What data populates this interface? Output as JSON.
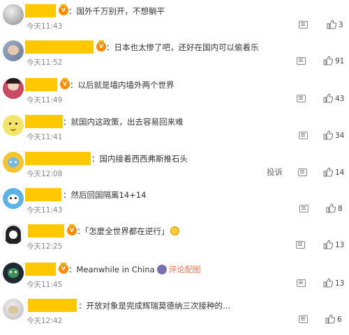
{
  "comments": [
    {
      "text": "：国外千万别开，不想躺平",
      "time": "今天11:43",
      "likes": "3"
    },
    {
      "text": "：日本也太惨了吧，还好在国内可以偷着乐",
      "time": "今天11:52",
      "likes": "91"
    },
    {
      "text": "：以后就是墙内墙外两个世界",
      "time": "今天11:49",
      "likes": "43"
    },
    {
      "text": "：就国内这政策，出去容易回来难",
      "time": "今天11:41",
      "likes": "34"
    },
    {
      "text": "：国内接着西西弗斯推石头",
      "time": "今天12:08",
      "likes": "14",
      "report": "投诉"
    },
    {
      "text": "：然后回国隔离14+14",
      "time": "今天11:43",
      "likes": "8"
    },
    {
      "text": "：「怎麼全世界都在逆行」",
      "time": "今天12:25",
      "likes": "13"
    },
    {
      "text": "：Meanwhile in China",
      "link": "评论配图",
      "time": "今天11:45",
      "likes": "13"
    },
    {
      "text": "：开放对象是完成辉瑞莫德纳三次接种的...",
      "time": "今天12:42",
      "likes": "6"
    }
  ],
  "colors": {
    "name_mask": "#ffc800",
    "link": "#eb7350"
  },
  "icons": {
    "reply": "comment-icon",
    "like": "thumbs-up-icon",
    "badge": "vip-badge-icon",
    "emoji": "laughing-emoji-icon"
  }
}
